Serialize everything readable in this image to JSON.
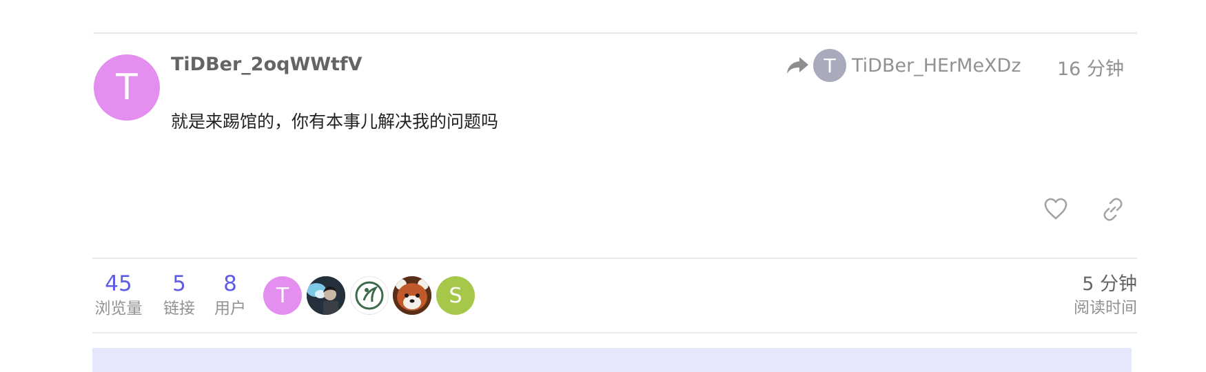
{
  "post": {
    "author": "TiDBer_2oqWWtfV",
    "author_initial": "T",
    "author_color": "#e48ff0",
    "reply_to": {
      "name": "TiDBer_HErMeXDz",
      "initial": "T",
      "color": "#a9abbd"
    },
    "time": "16 分钟",
    "body": "就是来踢馆的，你有本事儿解决我的问题吗"
  },
  "actions": {
    "like_icon": "heart-icon",
    "link_icon": "link-icon"
  },
  "summary": {
    "views": {
      "value": "45",
      "label": "浏览量"
    },
    "links": {
      "value": "5",
      "label": "链接"
    },
    "users": {
      "value": "8",
      "label": "用户"
    },
    "participants": [
      {
        "type": "letter",
        "initial": "T",
        "color": "#e48ff0"
      },
      {
        "type": "photo",
        "icon": "person-photo-avatar"
      },
      {
        "type": "photo",
        "icon": "logo-avatar"
      },
      {
        "type": "photo",
        "icon": "red-panda-avatar"
      },
      {
        "type": "letter",
        "initial": "S",
        "color": "#a5c84a"
      }
    ],
    "read_time": {
      "value": "5 分钟",
      "label": "阅读时间"
    }
  },
  "colors": {
    "accent": "#5e5ce6",
    "muted": "#919191",
    "bottom_bar": "#e7e7fb"
  }
}
